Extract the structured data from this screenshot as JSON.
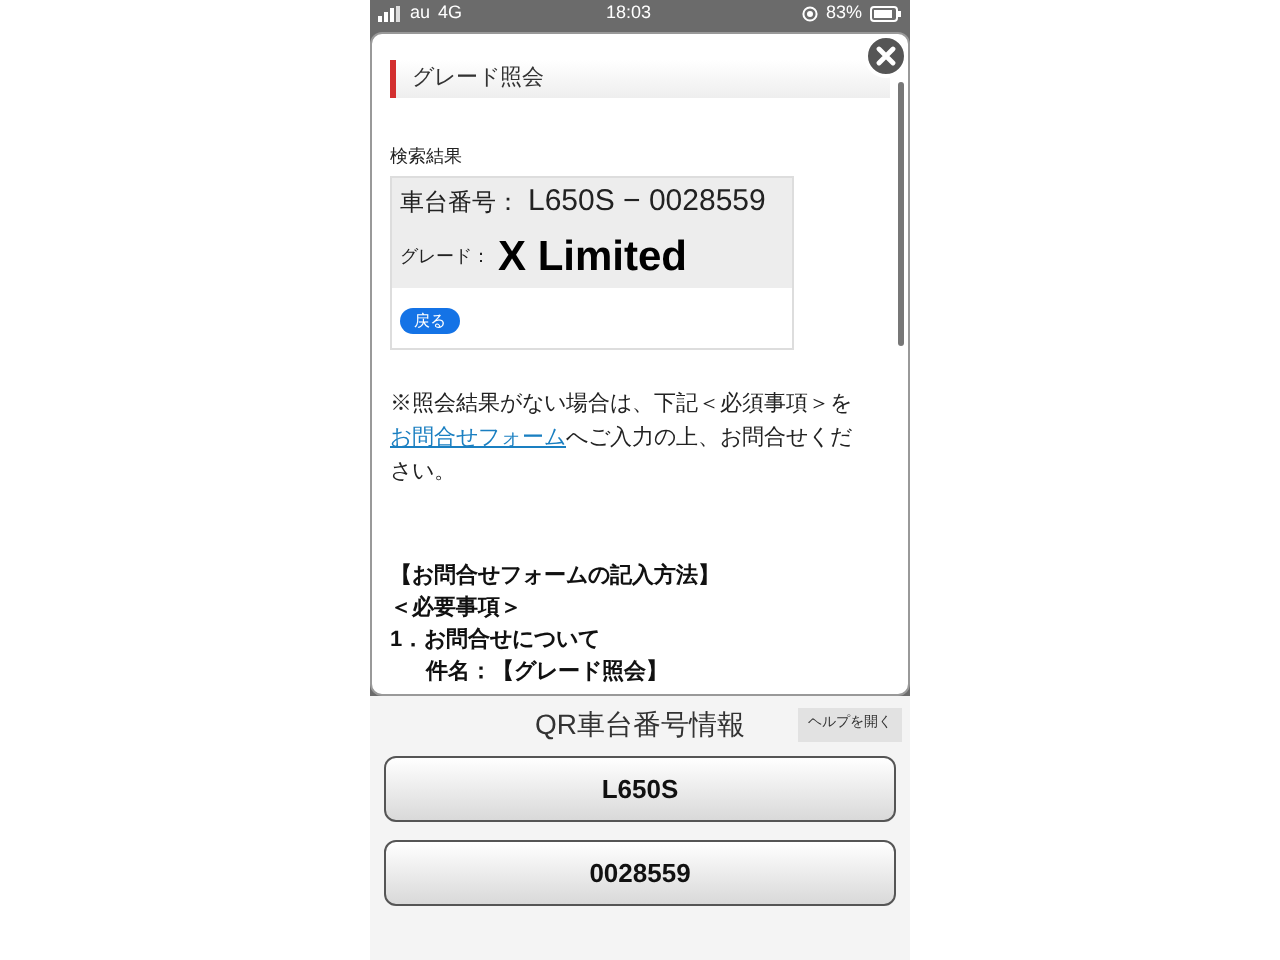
{
  "status_bar": {
    "carrier": "au",
    "network": "4G",
    "time": "18:03",
    "battery": "83%"
  },
  "dialog": {
    "title": "グレード照会",
    "section_label": "検索結果",
    "results": [
      {
        "label": "車台番号：",
        "value": "L650S − 0028559",
        "emphasis": false
      },
      {
        "label": "グレード：",
        "value": "X Limited",
        "emphasis": true
      }
    ],
    "back_button": "戻る",
    "note": {
      "before": "※照会結果がない場合は、下記＜必須事項＞を",
      "link": "お問合せフォーム",
      "after": "へご入力の上、お問合せください。"
    },
    "instructions": [
      {
        "text": "【お問合せフォームの記入方法】",
        "indent": false
      },
      {
        "text": "＜必要事項＞",
        "indent": false
      },
      {
        "text": "1．お問合せについて",
        "indent": false
      },
      {
        "text": "件名：【グレード照会】",
        "indent": true
      }
    ]
  },
  "footer": {
    "title": "QR車台番号情報",
    "help_button": "ヘルプを開く",
    "buttons": [
      "L650S",
      "0028559"
    ]
  }
}
